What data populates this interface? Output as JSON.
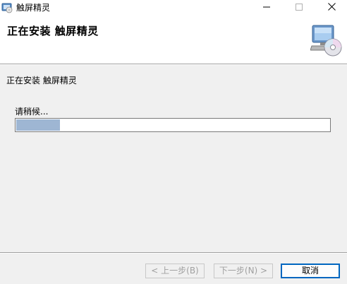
{
  "window": {
    "title": "触屏精灵",
    "icon": "installer-disc-icon"
  },
  "banner": {
    "title": "正在安装 触屏精灵",
    "icon": "computer-cd-icon"
  },
  "body": {
    "status": "正在安装 触屏精灵",
    "wait_label": "请稍候...",
    "progress_fraction": 0.14,
    "progress_color": "#9eb6d3"
  },
  "buttons": {
    "back": "< 上一步(B)",
    "next": "下一步(N) >",
    "cancel": "取消"
  }
}
